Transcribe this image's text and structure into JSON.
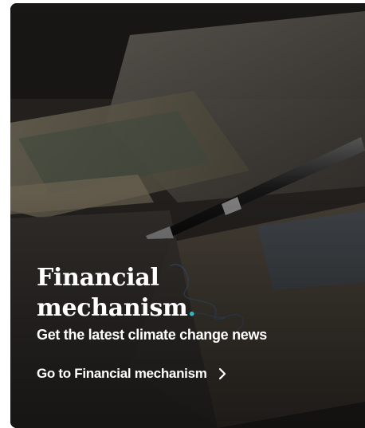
{
  "card": {
    "title_line1": "Financial",
    "title_line2": "mechanism",
    "title_dot": ".",
    "subtitle": "Get the latest climate change news",
    "link_label": "Go to Financial mechanism",
    "link_icon": "chevron-right-icon",
    "accent_color": "#35b5c2"
  }
}
